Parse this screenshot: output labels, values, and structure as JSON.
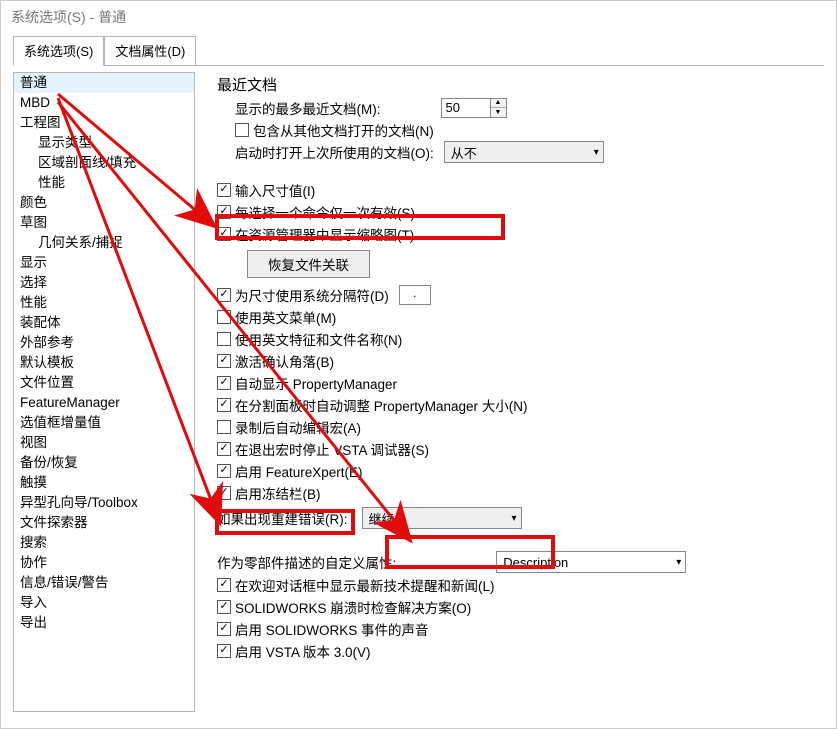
{
  "window": {
    "title": "系统选项(S) - 普通"
  },
  "tabs": {
    "system": "系统选项(S)",
    "docprops": "文档属性(D)"
  },
  "tree": {
    "items": [
      {
        "label": "普通",
        "hl": true
      },
      {
        "label": "MBD"
      },
      {
        "label": "工程图"
      },
      {
        "label": "显示类型",
        "child": true
      },
      {
        "label": "区域剖面线/填充",
        "child": true
      },
      {
        "label": "性能",
        "child": true
      },
      {
        "label": "颜色"
      },
      {
        "label": "草图"
      },
      {
        "label": "几何关系/捕捉",
        "child": true
      },
      {
        "label": "显示"
      },
      {
        "label": "选择"
      },
      {
        "label": "性能"
      },
      {
        "label": "装配体"
      },
      {
        "label": "外部参考"
      },
      {
        "label": "默认模板"
      },
      {
        "label": "文件位置"
      },
      {
        "label": "FeatureManager"
      },
      {
        "label": "选值框增量值"
      },
      {
        "label": "视图"
      },
      {
        "label": "备份/恢复"
      },
      {
        "label": "触摸"
      },
      {
        "label": "异型孔向导/Toolbox"
      },
      {
        "label": "文件探索器"
      },
      {
        "label": "搜索"
      },
      {
        "label": "协作"
      },
      {
        "label": "信息/错误/警告"
      },
      {
        "label": "导入"
      },
      {
        "label": "导出"
      }
    ]
  },
  "recent": {
    "title": "最近文档",
    "max_label": "显示的最多最近文档(M):",
    "max_value": "50",
    "include_other": "包含从其他文档打开的文档(N)",
    "open_last_label": "启动时打开上次所使用的文档(O):",
    "open_last_value": "从不"
  },
  "checks": {
    "c1": {
      "label": "输入尺寸值(I)",
      "checked": true
    },
    "c2": {
      "label": "每选择一个命令仅一次有效(S)",
      "checked": true
    },
    "c3": {
      "label": "在资源管理器中显示缩略图(T)",
      "checked": true
    },
    "c4": {
      "label": "为尺寸使用系统分隔符(D)",
      "checked": true
    },
    "c5": {
      "label": "使用英文菜单(M)",
      "checked": false
    },
    "c6": {
      "label": "使用英文特征和文件名称(N)",
      "checked": false
    },
    "c7": {
      "label": "激活确认角落(B)",
      "checked": true
    },
    "c8": {
      "label": "自动显示 PropertyManager",
      "checked": true
    },
    "c9": {
      "label": "在分割面板时自动调整 PropertyManager 大小(N)",
      "checked": true
    },
    "c10": {
      "label": "录制后自动编辑宏(A)",
      "checked": false
    },
    "c11": {
      "label": "在退出宏时停止 VSTA 调试器(S)",
      "checked": true
    },
    "c12": {
      "label": "启用 FeatureXpert(E)",
      "checked": true
    },
    "c13": {
      "label": "启用冻结栏(B)",
      "checked": true
    },
    "c14": {
      "label": "在欢迎对话框中显示最新技术提醒和新闻(L)",
      "checked": true
    },
    "c15": {
      "label": "SOLIDWORKS 崩溃时检查解决方案(O)",
      "checked": true
    },
    "c16": {
      "label": "启用 SOLIDWORKS 事件的声音",
      "checked": true
    },
    "c17": {
      "label": "启用 VSTA 版本 3.0(V)",
      "checked": true
    }
  },
  "restore_btn": "恢复文件关联",
  "decimal_sep": ".",
  "rebuild_err": {
    "label": "如果出现重建错误(R):",
    "value": "继续"
  },
  "custom_prop": {
    "label": "作为零部件描述的自定义属性:",
    "value": "Description"
  }
}
